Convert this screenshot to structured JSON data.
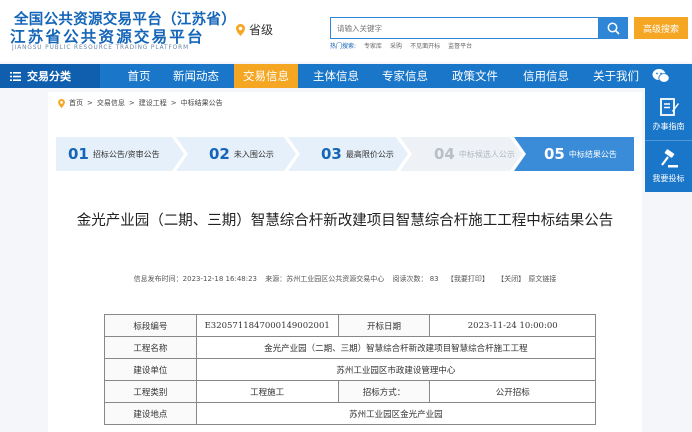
{
  "header": {
    "logo_line1": "全国公共资源交易平台（江苏省）",
    "logo_line2": "江苏省公共资源交易平台",
    "logo_line3": "JIANGSU PUBLIC RESOURCE TRADING PLATFORM",
    "region": "省级",
    "search_placeholder": "请输入关键字",
    "advanced_search": "高级搜索",
    "hot_label": "热门搜索:",
    "hot_terms": [
      "专家库",
      "采购",
      "不见面开标",
      "监督平台"
    ]
  },
  "nav": {
    "category": "交易分类",
    "items": [
      "首页",
      "新闻动态",
      "交易信息",
      "主体信息",
      "专家信息",
      "政策文件",
      "信用信息",
      "关于我们"
    ],
    "active_index": 2
  },
  "side_float": {
    "items": [
      {
        "label": "办事指南",
        "icon": "edit-icon"
      },
      {
        "label": "我要投标",
        "icon": "gavel-icon"
      }
    ]
  },
  "breadcrumb": [
    "首页",
    "交易信息",
    "建设工程",
    "中标结果公告"
  ],
  "steps": [
    {
      "num": "01",
      "label": "招标公告/资审公告",
      "state": "done"
    },
    {
      "num": "02",
      "label": "未入围公示",
      "state": "done"
    },
    {
      "num": "03",
      "label": "最高限价公示",
      "state": "done"
    },
    {
      "num": "04",
      "label": "中标候选人公示",
      "state": "disabled"
    },
    {
      "num": "05",
      "label": "中标结果公告",
      "state": "active"
    }
  ],
  "article": {
    "title": "金光产业园（二期、三期）智慧综合杆新改建项目智慧综合杆施工工程中标结果公告",
    "meta": {
      "publish_time": "信息发布时间：2023-12-18 16:48:23",
      "source": "来源：苏州工业园区公共资源交易中心",
      "views": "阅读次数：  83",
      "print": "【我要打印】",
      "close": "【关闭】",
      "link": "原文链接"
    }
  },
  "table": {
    "row1": {
      "k1": "标段编号",
      "v1": "E3205711847000149002001",
      "k2": "开标日期",
      "v2": "2023-11-24 10:00:00"
    },
    "row2": {
      "k": "工程名称",
      "v": "金光产业园（二期、三期）智慧综合杆新改建项目智慧综合杆施工工程"
    },
    "row3": {
      "k": "建设单位",
      "v": "苏州工业园区市政建设管理中心"
    },
    "row4": {
      "k1": "工程类别",
      "v1": "工程施工",
      "k2": "招标方式：",
      "v2": "公开招标"
    },
    "row5": {
      "k": "建设地点",
      "v": "苏州工业园区金光产业园"
    }
  },
  "colors": {
    "primary": "#1976c9",
    "nav_dark": "#0f5fae",
    "accent": "#f5a623",
    "step_bg": "#e6f0fa",
    "step_active": "#3a8bd8"
  }
}
